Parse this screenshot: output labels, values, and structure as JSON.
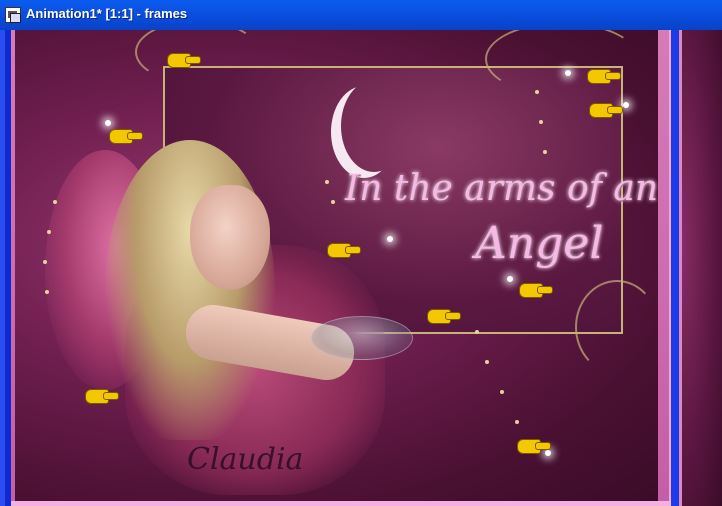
{
  "window": {
    "title": "Animation1* [1:1] - frames",
    "icon": "animation-shop-icon"
  },
  "canvas": {
    "headline_line1": "In the arms of an",
    "headline_line2": "Angel",
    "signature": "Claudia",
    "pointer_icon": "pointing-hand-icon",
    "accent_colors": {
      "title_pink": "#f6b8e4",
      "frame_gold": "#c8b27a",
      "background_plum": "#6e1e4e",
      "window_blue": "#0a5cf0"
    }
  }
}
